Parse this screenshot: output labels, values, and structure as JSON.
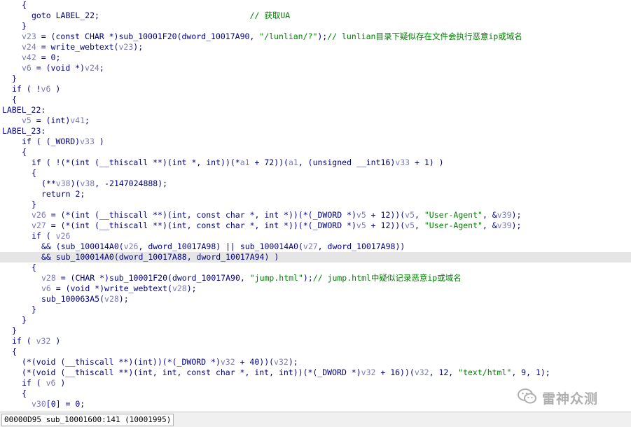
{
  "editor": {
    "lines": [
      {
        "tokens": [
          [
            "kw",
            "{"
          ]
        ],
        "indent": 4
      },
      {
        "tokens": [
          [
            "kw",
            "goto LABEL_22;                               "
          ],
          [
            "cm",
            "// 获取UA"
          ]
        ],
        "indent": 6
      },
      {
        "tokens": [
          [
            "kw",
            "}"
          ]
        ],
        "indent": 4
      },
      {
        "tokens": [
          [
            "var",
            "v23"
          ],
          [
            "kw",
            " = (const CHAR *)sub_10001F20(dword_10017A90, "
          ],
          [
            "str",
            "\"/lunlian/?\""
          ],
          [
            "kw",
            ");"
          ],
          [
            "cm",
            "// lunlian目录下疑似存在文件会执行恶意ip或域名"
          ]
        ],
        "indent": 4
      },
      {
        "tokens": [
          [
            "var",
            "v24"
          ],
          [
            "kw",
            " = write_webtext("
          ],
          [
            "var",
            "v23"
          ],
          [
            "kw",
            ");"
          ]
        ],
        "indent": 4
      },
      {
        "tokens": [
          [
            "var",
            "v42"
          ],
          [
            "kw",
            " = 0;"
          ]
        ],
        "indent": 4
      },
      {
        "tokens": [
          [
            "var",
            "v6"
          ],
          [
            "kw",
            " = (void *)"
          ],
          [
            "var",
            "v24"
          ],
          [
            "kw",
            ";"
          ]
        ],
        "indent": 4
      },
      {
        "tokens": [
          [
            "kw",
            "}"
          ]
        ],
        "indent": 2
      },
      {
        "tokens": [
          [
            "kw",
            "if ( !"
          ],
          [
            "var",
            "v6"
          ],
          [
            "kw",
            " )"
          ]
        ],
        "indent": 2
      },
      {
        "tokens": [
          [
            "kw",
            "{"
          ]
        ],
        "indent": 2
      },
      {
        "tokens": [
          [
            "kw",
            "LABEL_22:"
          ]
        ],
        "indent": 0
      },
      {
        "tokens": [
          [
            "var",
            "v5"
          ],
          [
            "kw",
            " = (int)"
          ],
          [
            "var",
            "v41"
          ],
          [
            "kw",
            ";"
          ]
        ],
        "indent": 4
      },
      {
        "tokens": [
          [
            "kw",
            "LABEL_23:"
          ]
        ],
        "indent": 0
      },
      {
        "tokens": [
          [
            "kw",
            "if ( (_WORD)"
          ],
          [
            "var",
            "v33"
          ],
          [
            "kw",
            " )"
          ]
        ],
        "indent": 4
      },
      {
        "tokens": [
          [
            "kw",
            "{"
          ]
        ],
        "indent": 4
      },
      {
        "tokens": [
          [
            "kw",
            "if ( !(*(int (__thiscall **)(int *, int))(*"
          ],
          [
            "var",
            "a1"
          ],
          [
            "kw",
            " + 72))("
          ],
          [
            "var",
            "a1"
          ],
          [
            "kw",
            ", (unsigned __int16)"
          ],
          [
            "var",
            "v33"
          ],
          [
            "kw",
            " + 1) )"
          ]
        ],
        "indent": 6
      },
      {
        "tokens": [
          [
            "kw",
            "{"
          ]
        ],
        "indent": 6
      },
      {
        "tokens": [
          [
            "kw",
            "(**"
          ],
          [
            "var",
            "v38"
          ],
          [
            "kw",
            ")("
          ],
          [
            "var",
            "v38"
          ],
          [
            "kw",
            ", -2147024888);"
          ]
        ],
        "indent": 8
      },
      {
        "tokens": [
          [
            "kw",
            "return 2;"
          ]
        ],
        "indent": 8
      },
      {
        "tokens": [
          [
            "kw",
            "}"
          ]
        ],
        "indent": 6
      },
      {
        "tokens": [
          [
            "var",
            "v26"
          ],
          [
            "kw",
            " = (*(int (__thiscall **)(int, const char *, int *))(*(_DWORD *)"
          ],
          [
            "var",
            "v5"
          ],
          [
            "kw",
            " + 12))("
          ],
          [
            "var",
            "v5"
          ],
          [
            "kw",
            ", "
          ],
          [
            "str",
            "\"User-Agent\""
          ],
          [
            "kw",
            ", &"
          ],
          [
            "var",
            "v39"
          ],
          [
            "kw",
            ");"
          ]
        ],
        "indent": 6
      },
      {
        "tokens": [
          [
            "var",
            "v27"
          ],
          [
            "kw",
            " = (*(int (__thiscall **)(int, const char *, int *))(*(_DWORD *)"
          ],
          [
            "var",
            "v5"
          ],
          [
            "kw",
            " + 12))("
          ],
          [
            "var",
            "v5"
          ],
          [
            "kw",
            ", "
          ],
          [
            "str",
            "\"User-Agent\""
          ],
          [
            "kw",
            ", &"
          ],
          [
            "var",
            "v39"
          ],
          [
            "kw",
            ");"
          ]
        ],
        "indent": 6
      },
      {
        "tokens": [
          [
            "kw",
            "if ( "
          ],
          [
            "var",
            "v26"
          ]
        ],
        "indent": 6
      },
      {
        "tokens": [
          [
            "kw",
            "&& (sub_100014A0("
          ],
          [
            "var",
            "v26"
          ],
          [
            "kw",
            ", dword_10017A98) || sub_100014A0("
          ],
          [
            "var",
            "v27"
          ],
          [
            "kw",
            ", dword_10017A98))"
          ]
        ],
        "indent": 8
      },
      {
        "tokens": [
          [
            "kw",
            "&& sub_100014A0(dword_10017A88, dword_10017A94) )"
          ]
        ],
        "indent": 8,
        "highlight": true
      },
      {
        "tokens": [
          [
            "kw",
            "{"
          ]
        ],
        "indent": 6
      },
      {
        "tokens": [
          [
            "var",
            "v28"
          ],
          [
            "kw",
            " = (CHAR *)sub_10001F20(dword_10017A90, "
          ],
          [
            "str",
            "\"jump.html\""
          ],
          [
            "kw",
            ");"
          ],
          [
            "cm",
            "// jump.html中疑似记录恶意ip或域名"
          ]
        ],
        "indent": 8
      },
      {
        "tokens": [
          [
            "var",
            "v6"
          ],
          [
            "kw",
            " = (void *)write_webtext("
          ],
          [
            "var",
            "v28"
          ],
          [
            "kw",
            ");"
          ]
        ],
        "indent": 8
      },
      {
        "tokens": [
          [
            "kw",
            "sub_100063A5("
          ],
          [
            "var",
            "v28"
          ],
          [
            "kw",
            ");"
          ]
        ],
        "indent": 8
      },
      {
        "tokens": [
          [
            "kw",
            "}"
          ]
        ],
        "indent": 6
      },
      {
        "tokens": [
          [
            "kw",
            "}"
          ]
        ],
        "indent": 4
      },
      {
        "tokens": [
          [
            "kw",
            "}"
          ]
        ],
        "indent": 2
      },
      {
        "tokens": [
          [
            "kw",
            "if ( "
          ],
          [
            "var",
            "v32"
          ],
          [
            "kw",
            " )"
          ]
        ],
        "indent": 2
      },
      {
        "tokens": [
          [
            "kw",
            "{"
          ]
        ],
        "indent": 2
      },
      {
        "tokens": [
          [
            "kw",
            "(*(void (__thiscall **)(int))(*(_DWORD *)"
          ],
          [
            "var",
            "v32"
          ],
          [
            "kw",
            " + 40))("
          ],
          [
            "var",
            "v32"
          ],
          [
            "kw",
            ");"
          ]
        ],
        "indent": 4
      },
      {
        "tokens": [
          [
            "kw",
            "(*(void (__thiscall **)(int, int, const char *, int, int))(*(_DWORD *)"
          ],
          [
            "var",
            "v32"
          ],
          [
            "kw",
            " + 16))("
          ],
          [
            "var",
            "v32"
          ],
          [
            "kw",
            ", 12, "
          ],
          [
            "str",
            "\"text/html\""
          ],
          [
            "kw",
            ", 9, 1);"
          ]
        ],
        "indent": 4
      },
      {
        "tokens": [
          [
            "kw",
            "if ( "
          ],
          [
            "var",
            "v6"
          ],
          [
            "kw",
            " )"
          ]
        ],
        "indent": 4
      },
      {
        "tokens": [
          [
            "kw",
            "{"
          ]
        ],
        "indent": 4
      },
      {
        "tokens": [
          [
            "var",
            "v30"
          ],
          [
            "kw",
            "[0] = 0;"
          ]
        ],
        "indent": 6
      }
    ]
  },
  "status_bar": {
    "text": "00000D95 sub_10001600:141 (10001995)"
  },
  "watermark": {
    "text": "雷神众测",
    "icon": "wechat-icon"
  },
  "colors": {
    "code": "#000080",
    "variable": "#7a7ab8",
    "string": "#008000",
    "comment": "#008000",
    "highlight": "#e5e5e5"
  }
}
